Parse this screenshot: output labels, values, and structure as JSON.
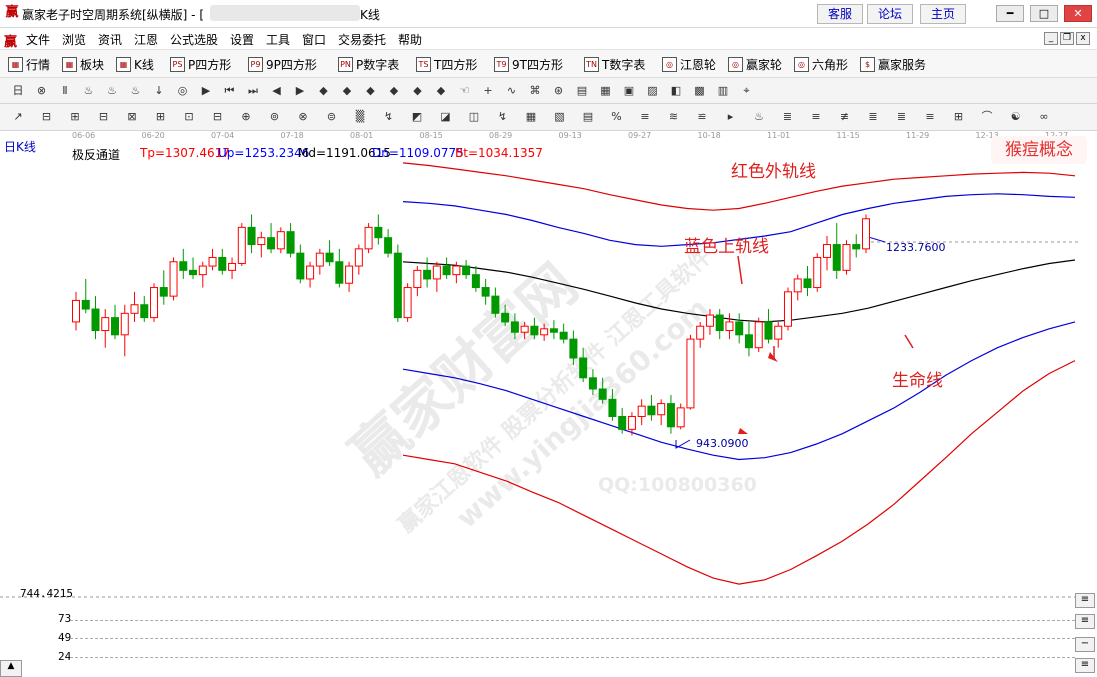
{
  "window": {
    "title_prefix": "赢家老子时空周期系统[纵横版] - [",
    "title_suffix": "K线",
    "top_links": [
      "客服",
      "论坛",
      "主页"
    ],
    "logo_glyph": "赢"
  },
  "menu": [
    "文件",
    "浏览",
    "资讯",
    "江恩",
    "公式选股",
    "设置",
    "工具",
    "窗口",
    "交易委托",
    "帮助"
  ],
  "toolbar1": [
    {
      "label": "行情",
      "icon": "grid-icon"
    },
    {
      "label": "板块",
      "icon": "sector-icon"
    },
    {
      "label": "K线",
      "icon": "kline-icon"
    },
    {
      "label": "P四方形",
      "icon": "ps-icon",
      "glyph": "PS"
    },
    {
      "label": "9P四方形",
      "icon": "p9-icon",
      "glyph": "P9"
    },
    {
      "label": "P数字表",
      "icon": "pn-icon",
      "glyph": "PN"
    },
    {
      "label": "T四方形",
      "icon": "ts-icon",
      "glyph": "TS"
    },
    {
      "label": "9T四方形",
      "icon": "t9-icon",
      "glyph": "T9"
    },
    {
      "label": "T数字表",
      "icon": "tn-icon",
      "glyph": "TN"
    },
    {
      "label": "江恩轮",
      "icon": "gann-wheel-icon",
      "glyph": "◎"
    },
    {
      "label": "赢家轮",
      "icon": "winner-wheel-icon",
      "glyph": "◎"
    },
    {
      "label": "六角形",
      "icon": "hexagon-icon",
      "glyph": "◎"
    },
    {
      "label": "赢家服务",
      "icon": "dollar-icon",
      "glyph": "$"
    }
  ],
  "toolbar2_icons": [
    "日",
    "⊗",
    "Ⅱ",
    "♨",
    "♨",
    "♨",
    "↓",
    "◎",
    "▶",
    "⏮",
    "⏭",
    "◀",
    "▶",
    "◆",
    "◆",
    "◆",
    "◆",
    "◆",
    "◆",
    "☜",
    "+",
    "∿",
    "⌘",
    "⊛",
    "▤",
    "▦",
    "▣",
    "▨",
    "◧",
    "▩",
    "▥",
    "⌖"
  ],
  "toolbar3_icons": [
    "↗",
    "⊟",
    "⊞",
    "⊟",
    "⊠",
    "⊞",
    "⊡",
    "⊟",
    "⊕",
    "⊚",
    "⊗",
    "⊜",
    "▒",
    "↯",
    "◩",
    "◪",
    "◫",
    "↯",
    "▦",
    "▧",
    "▤",
    "%",
    "≡",
    "≋",
    "≌",
    "▸",
    "♨",
    "≣",
    "≡",
    "≢",
    "≣",
    "≣",
    "≡",
    "⊞",
    "⌒",
    "☯",
    "∞"
  ],
  "dates": [
    "06-06",
    "06-20",
    "07-04",
    "07-18",
    "08-01",
    "08-15",
    "08-29",
    "09-13",
    "09-27",
    "10-18",
    "11-01",
    "11-15",
    "11-29",
    "12-13",
    "12-27"
  ],
  "period": "日K线",
  "indicator": {
    "name": "极反通道",
    "tp": "Tp=1307.4617",
    "up": "Up=1253.2346",
    "md": "Md=1191.0615",
    "dn": "Dn=1109.0775",
    "bt": "Bt=1034.1357"
  },
  "concept": "猴痘概念",
  "annotations": {
    "red_outer": "红色外轨线",
    "blue_upper": "蓝色上轨线",
    "life_line": "生命线"
  },
  "price_labels": {
    "high": "1233.7600",
    "low": "943.0900"
  },
  "axis_numbers": [
    "744.4215",
    "73",
    "49",
    "24"
  ],
  "watermarks": [
    "赢家财富网",
    "赢家江恩软件 股票分析软件 江恩工具软件",
    "www.yingjia360.com",
    "QQ:100800360"
  ],
  "colors": {
    "up": "#ff0000",
    "down": "#009900",
    "outer": "#e00000",
    "channel": "#0000dd",
    "mid": "#000000"
  },
  "chart_data": {
    "type": "candlestick",
    "title": "",
    "series": [
      {
        "name": "Tp",
        "values": [
          1307.4617
        ]
      },
      {
        "name": "Up",
        "values": [
          1253.2346
        ]
      },
      {
        "name": "Md",
        "values": [
          1191.0615
        ]
      },
      {
        "name": "Dn",
        "values": [
          1109.0775
        ]
      },
      {
        "name": "Bt",
        "values": [
          1034.1357
        ]
      }
    ],
    "ohlc": [
      [
        1160,
        1195,
        1150,
        1185
      ],
      [
        1185,
        1210,
        1170,
        1175
      ],
      [
        1175,
        1190,
        1140,
        1150
      ],
      [
        1150,
        1175,
        1130,
        1165
      ],
      [
        1165,
        1180,
        1140,
        1145
      ],
      [
        1145,
        1180,
        1120,
        1170
      ],
      [
        1170,
        1195,
        1160,
        1180
      ],
      [
        1180,
        1190,
        1160,
        1165
      ],
      [
        1165,
        1205,
        1160,
        1200
      ],
      [
        1200,
        1220,
        1180,
        1190
      ],
      [
        1190,
        1235,
        1185,
        1230
      ],
      [
        1230,
        1245,
        1210,
        1220
      ],
      [
        1220,
        1235,
        1210,
        1215
      ],
      [
        1215,
        1230,
        1200,
        1225
      ],
      [
        1225,
        1245,
        1220,
        1235
      ],
      [
        1235,
        1245,
        1215,
        1220
      ],
      [
        1220,
        1235,
        1210,
        1228
      ],
      [
        1228,
        1275,
        1225,
        1270
      ],
      [
        1270,
        1285,
        1240,
        1250
      ],
      [
        1250,
        1265,
        1235,
        1258
      ],
      [
        1258,
        1275,
        1240,
        1245
      ],
      [
        1245,
        1270,
        1240,
        1265
      ],
      [
        1265,
        1275,
        1235,
        1240
      ],
      [
        1240,
        1250,
        1205,
        1210
      ],
      [
        1210,
        1230,
        1200,
        1225
      ],
      [
        1225,
        1245,
        1215,
        1240
      ],
      [
        1240,
        1255,
        1225,
        1230
      ],
      [
        1230,
        1245,
        1200,
        1205
      ],
      [
        1205,
        1230,
        1195,
        1225
      ],
      [
        1225,
        1250,
        1215,
        1245
      ],
      [
        1245,
        1275,
        1240,
        1270
      ],
      [
        1270,
        1285,
        1250,
        1258
      ],
      [
        1258,
        1268,
        1235,
        1240
      ],
      [
        1240,
        1250,
        1160,
        1165
      ],
      [
        1165,
        1205,
        1160,
        1200
      ],
      [
        1200,
        1225,
        1190,
        1220
      ],
      [
        1220,
        1235,
        1200,
        1210
      ],
      [
        1210,
        1230,
        1195,
        1225
      ],
      [
        1225,
        1235,
        1210,
        1215
      ],
      [
        1215,
        1230,
        1205,
        1225
      ],
      [
        1225,
        1232,
        1210,
        1215
      ],
      [
        1215,
        1225,
        1195,
        1200
      ],
      [
        1200,
        1210,
        1180,
        1190
      ],
      [
        1190,
        1200,
        1165,
        1170
      ],
      [
        1170,
        1180,
        1155,
        1160
      ],
      [
        1160,
        1170,
        1140,
        1148
      ],
      [
        1148,
        1160,
        1140,
        1155
      ],
      [
        1155,
        1165,
        1140,
        1145
      ],
      [
        1145,
        1158,
        1138,
        1152
      ],
      [
        1152,
        1162,
        1140,
        1148
      ],
      [
        1148,
        1158,
        1135,
        1140
      ],
      [
        1140,
        1150,
        1110,
        1118
      ],
      [
        1118,
        1130,
        1090,
        1095
      ],
      [
        1095,
        1105,
        1075,
        1082
      ],
      [
        1082,
        1095,
        1065,
        1070
      ],
      [
        1070,
        1082,
        1045,
        1050
      ],
      [
        1050,
        1060,
        1030,
        1035
      ],
      [
        1035,
        1055,
        1028,
        1050
      ],
      [
        1050,
        1070,
        1040,
        1062
      ],
      [
        1062,
        1075,
        1045,
        1052
      ],
      [
        1052,
        1070,
        1040,
        1065
      ],
      [
        1065,
        1075,
        1030,
        1038
      ],
      [
        1038,
        1065,
        1035,
        1060
      ],
      [
        1060,
        1145,
        1058,
        1140
      ],
      [
        1140,
        1160,
        1130,
        1155
      ],
      [
        1155,
        1175,
        1145,
        1168
      ],
      [
        1168,
        1175,
        1140,
        1150
      ],
      [
        1150,
        1170,
        1140,
        1160
      ],
      [
        1160,
        1170,
        1135,
        1145
      ],
      [
        1145,
        1160,
        1120,
        1130
      ],
      [
        1130,
        1165,
        1125,
        1160
      ],
      [
        1160,
        1175,
        1135,
        1140
      ],
      [
        1140,
        1160,
        1130,
        1155
      ],
      [
        1155,
        1200,
        1150,
        1195
      ],
      [
        1195,
        1215,
        1185,
        1210
      ],
      [
        1210,
        1225,
        1190,
        1200
      ],
      [
        1200,
        1240,
        1195,
        1235
      ],
      [
        1235,
        1260,
        1220,
        1250
      ],
      [
        1250,
        1275,
        1210,
        1220
      ],
      [
        1220,
        1255,
        1215,
        1250
      ],
      [
        1250,
        1262,
        1235,
        1245
      ],
      [
        1245,
        1285,
        1240,
        1280
      ]
    ],
    "outer_upper": [
      1345,
      1342,
      1338,
      1334,
      1330,
      1325,
      1320,
      1315,
      1308,
      1302,
      1296,
      1292,
      1290,
      1292,
      1298,
      1305,
      1312,
      1318,
      1322,
      1326,
      1328,
      1330,
      1332,
      1333,
      1334,
      1333,
      1330
    ],
    "channel_upper": [
      1300,
      1298,
      1295,
      1290,
      1285,
      1278,
      1270,
      1263,
      1255,
      1250,
      1248,
      1250,
      1252,
      1256,
      1260,
      1265,
      1275,
      1285,
      1292,
      1298,
      1302,
      1306,
      1308,
      1309,
      1308,
      1306,
      1305
    ],
    "middle": [
      1230,
      1228,
      1226,
      1222,
      1218,
      1212,
      1205,
      1198,
      1190,
      1182,
      1175,
      1170,
      1166,
      1162,
      1160,
      1162,
      1166,
      1170,
      1176,
      1184,
      1192,
      1200,
      1208,
      1215,
      1222,
      1228,
      1232
    ],
    "channel_lower": [
      1105,
      1100,
      1095,
      1088,
      1080,
      1070,
      1060,
      1050,
      1040,
      1030,
      1020,
      1012,
      1005,
      1000,
      1002,
      1008,
      1018,
      1030,
      1045,
      1060,
      1078,
      1098,
      1115,
      1130,
      1142,
      1152,
      1160
    ],
    "outer_lower": [
      1005,
      1000,
      995,
      985,
      975,
      962,
      950,
      935,
      920,
      905,
      890,
      875,
      862,
      855,
      860,
      872,
      888,
      905,
      925,
      948,
      975,
      1002,
      1030,
      1055,
      1080,
      1100,
      1115
    ],
    "ylim": [
      840,
      1360
    ]
  }
}
